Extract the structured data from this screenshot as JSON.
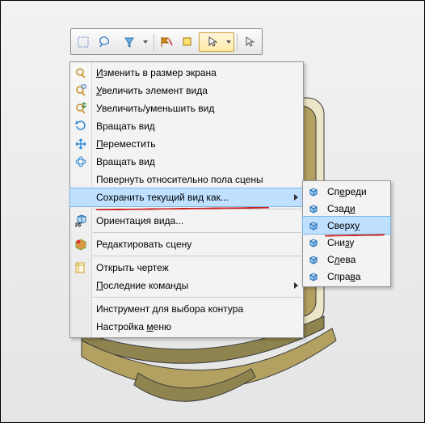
{
  "toolbar": {
    "buttons": [
      {
        "name": "select-box-icon"
      },
      {
        "name": "lasso-select-icon"
      },
      {
        "name": "filter-select-icon"
      },
      {
        "name": "flag-toggle-icon"
      },
      {
        "name": "small-select-icon"
      },
      {
        "name": "pointer-dd-icon"
      },
      {
        "name": "cursor-icon"
      }
    ]
  },
  "menu": {
    "items": [
      {
        "label": "Изменить в размер экрана",
        "u": 0,
        "icon": "zoom-fit-icon"
      },
      {
        "label": "Увеличить элемент вида",
        "u": 0,
        "icon": "zoom-element-icon"
      },
      {
        "label": "Увеличить/уменьшить вид",
        "u": -1,
        "icon": "zoom-inout-icon"
      },
      {
        "label": "Вращать вид",
        "u": -1,
        "icon": "rotate-icon"
      },
      {
        "label": "Переместить",
        "u": 0,
        "icon": "pan-icon"
      },
      {
        "label": "Вращать вид",
        "u": -1,
        "icon": "orbit-icon"
      },
      {
        "label": "Повернуть относительно пола сцены",
        "u": -1,
        "icon": ""
      },
      {
        "label": "Сохранить текущий вид как...",
        "u": -1,
        "icon": "",
        "arrow": true,
        "highlight": true
      }
    ],
    "items2": [
      {
        "label": "Ориентация вида...",
        "u": -1,
        "icon": "orient-icon"
      }
    ],
    "items3": [
      {
        "label": "Редактировать сцену",
        "u": -1,
        "icon": "scene-icon"
      }
    ],
    "items4": [
      {
        "label": "Открыть чертеж",
        "u": -1,
        "icon": "drawing-icon"
      },
      {
        "label": "Последние команды",
        "u": 0,
        "icon": "",
        "arrow": true
      }
    ],
    "items5": [
      {
        "label": "Инструмент для выбора контура",
        "u": -1,
        "icon": ""
      },
      {
        "label": "Настройка меню",
        "u": 10,
        "icon": ""
      }
    ]
  },
  "submenu": {
    "items": [
      {
        "label": "Спереди",
        "u": 2
      },
      {
        "label": "Сзади",
        "u": 4
      },
      {
        "label": "Сверху",
        "u": 5,
        "highlight": true
      },
      {
        "label": "Снизу",
        "u": 3
      },
      {
        "label": "Слева",
        "u": 1
      },
      {
        "label": "Справа",
        "u": 4
      }
    ]
  }
}
